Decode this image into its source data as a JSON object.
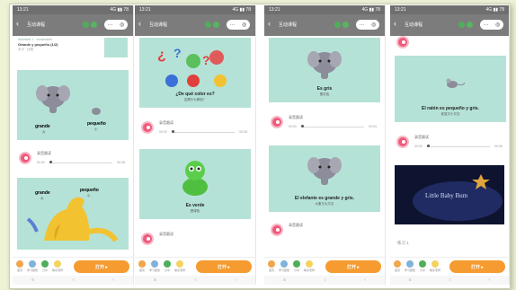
{
  "status_bar": {
    "time": "13:21",
    "signal": "4G ▮▮ 78"
  },
  "app": {
    "title": "互动课程",
    "back": "‹",
    "pill_dots": "···"
  },
  "phone1": {
    "header_line1": "Actividad 1 · vocabulario",
    "header_line2": "Grande y pequeño (1/2)",
    "header_line3": "大小 · 比较",
    "card1": {
      "left_word": "grande",
      "left_sub": "大",
      "right_word": "pequeño",
      "right_sub": "小"
    },
    "audio": {
      "label": "录音跟读",
      "time_start": "00:00",
      "time_end": "00:08"
    },
    "card2": {
      "left_word": "grande",
      "left_sub": "大",
      "right_word": "pequeño",
      "right_sub": "小"
    }
  },
  "phone2": {
    "card1": {
      "caption": "¿De qué color es?",
      "sub": "这是什么颜色？"
    },
    "audio": {
      "label": "录音跟读",
      "time_start": "00:00",
      "time_end": "00:05"
    },
    "card2": {
      "caption": "Es verde",
      "sub": "是绿色"
    },
    "audio2": {
      "label": "录音跟读"
    }
  },
  "phone3": {
    "card1": {
      "caption": "Es gris",
      "sub": "是灰色"
    },
    "audio": {
      "label": "录音跟读",
      "time_start": "00:00",
      "time_end": "00:04"
    },
    "card2": {
      "caption": "El elefante es grande y gris.",
      "sub": "大象又大又灰"
    },
    "audio2": {
      "label": "录音跟读"
    }
  },
  "phone4": {
    "card1": {
      "caption": "El ratón es pequeño y gris.",
      "sub": "老鼠又小又灰"
    },
    "audio": {
      "label": "录音跟读",
      "time_start": "00:00",
      "time_end": "00:06"
    },
    "video": {
      "title": "Little Baby Bum"
    },
    "section": "练习 1"
  },
  "bottom_bar": {
    "items": [
      "首页",
      "学习报告",
      "分享",
      "联系老师"
    ],
    "go_label": "打开 ▸"
  },
  "nav": {
    "items": [
      "≡",
      "○",
      "‹"
    ]
  },
  "colors": {
    "card_bg": "#b5e2d7",
    "accent": "#f59b2f",
    "play": "#ef5a7b",
    "appbar": "#7c7c7c"
  }
}
